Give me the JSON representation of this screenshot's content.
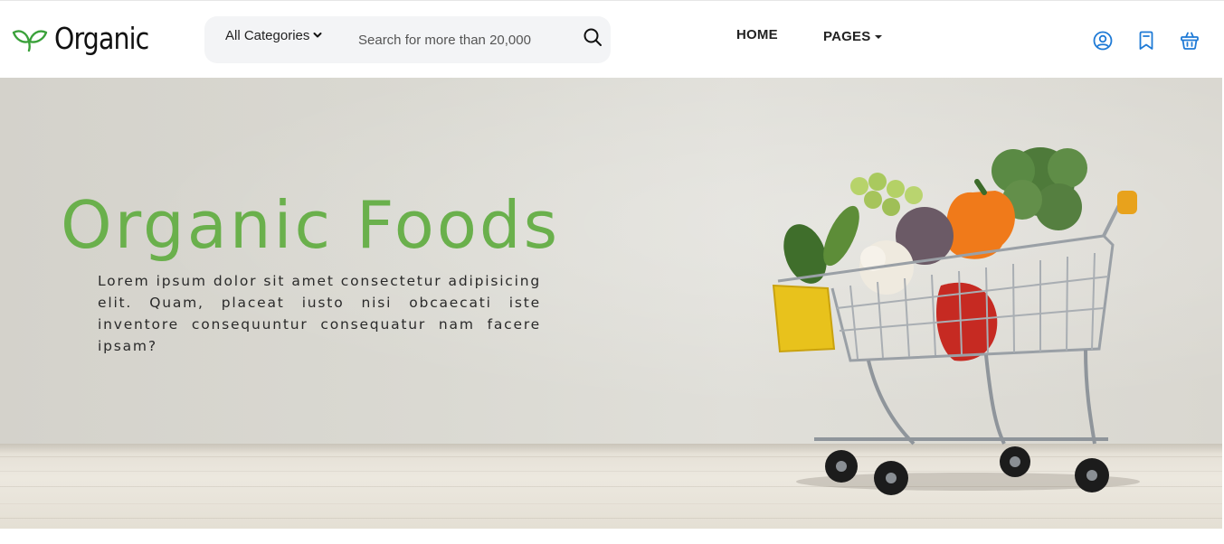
{
  "header": {
    "logo_text": "Organic",
    "search": {
      "category_label": "All Categories",
      "placeholder": "Search for more than 20,000"
    },
    "nav": {
      "home": "HOME",
      "pages": "PAGES"
    },
    "icons": [
      "user-icon",
      "bookmark-icon",
      "basket-icon"
    ]
  },
  "hero": {
    "title": "Organic Foods",
    "description": "Lorem ipsum dolor sit amet consectetur adipisicing elit. Quam, placeat iusto nisi obcaecati iste inventore consequuntur consequatur nam facere ipsam?",
    "image": "shopping-cart-with-vegetables"
  },
  "colors": {
    "brand_green": "#6ab04c",
    "icon_blue": "#1e7ad6",
    "search_bg": "#f3f4f6"
  }
}
